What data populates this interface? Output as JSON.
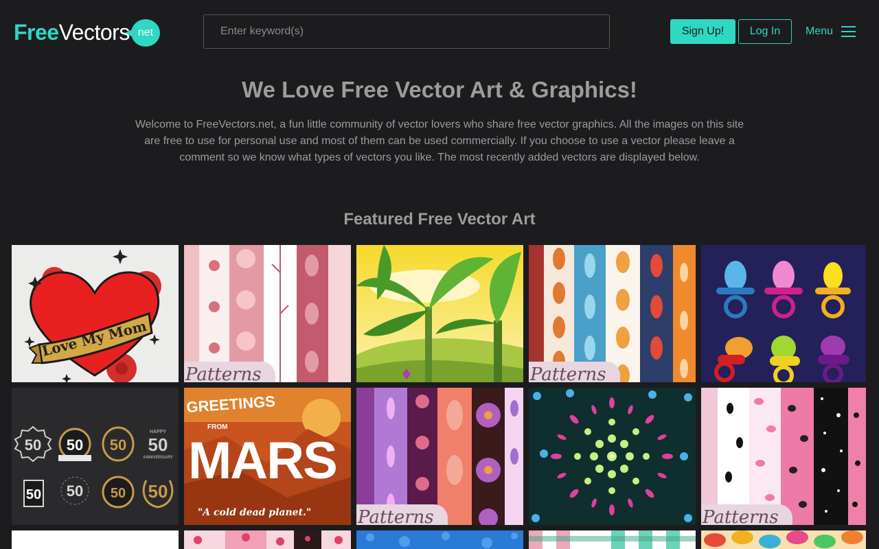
{
  "header": {
    "logo": {
      "free": "Free",
      "vectors": "Vectors",
      "badge": "net"
    },
    "search_placeholder": "Enter keyword(s)",
    "signup_label": "Sign Up!",
    "login_label": "Log In",
    "menu_label": "Menu"
  },
  "hero": {
    "title": "We Love Free Vector Art & Graphics!",
    "text": "Welcome to FreeVectors.net, a fun little community of vector lovers who share free vector graphics. All the images on this site are free to use for personal use and most of them can be used commercially. If you choose to use a vector please leave a comment so we know what types of vectors you like. The most recently added vectors are displayed below."
  },
  "featured": {
    "title": "Featured Free Vector Art",
    "tiles": [
      {
        "topic": "love-my-mom-heart",
        "text": "Love My Mom"
      },
      {
        "topic": "pink-patterns",
        "caption": "Patterns"
      },
      {
        "topic": "banana-trees"
      },
      {
        "topic": "leaf-patterns",
        "caption": "Patterns"
      },
      {
        "topic": "pacifiers"
      },
      {
        "topic": "anniversary-badges",
        "badge_text": "50",
        "badge_sub": "ANNIVERSARY",
        "badge_top": "HAPPY"
      },
      {
        "topic": "greetings-from-mars",
        "line1": "GREETINGS",
        "from": "FROM",
        "line2": "MARS",
        "tagline": "\"A cold dead planet.\""
      },
      {
        "topic": "floral-patterns",
        "caption": "Patterns"
      },
      {
        "topic": "gem-mandala"
      },
      {
        "topic": "spotted-patterns",
        "caption": "Patterns"
      },
      {
        "topic": "white-partial"
      },
      {
        "topic": "pink-partial"
      },
      {
        "topic": "blue-partial"
      },
      {
        "topic": "gingham-partial"
      },
      {
        "topic": "colorful-partial"
      }
    ]
  },
  "colors": {
    "background": "#1c1c1f",
    "accent": "#2ed8c3",
    "text": "#9c9c9c"
  }
}
